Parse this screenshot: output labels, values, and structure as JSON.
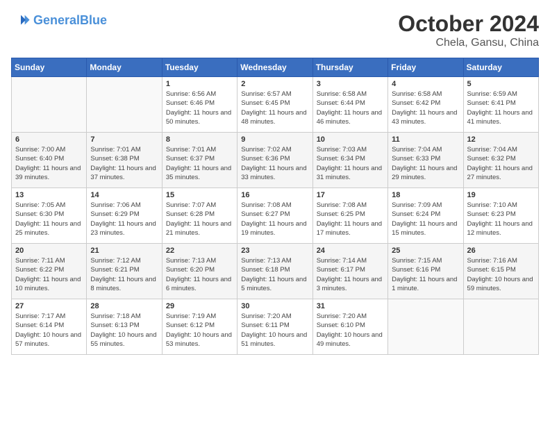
{
  "header": {
    "logo_line1": "General",
    "logo_line2": "Blue",
    "month": "October 2024",
    "location": "Chela, Gansu, China"
  },
  "weekdays": [
    "Sunday",
    "Monday",
    "Tuesday",
    "Wednesday",
    "Thursday",
    "Friday",
    "Saturday"
  ],
  "weeks": [
    [
      {
        "day": "",
        "detail": ""
      },
      {
        "day": "",
        "detail": ""
      },
      {
        "day": "1",
        "detail": "Sunrise: 6:56 AM\nSunset: 6:46 PM\nDaylight: 11 hours\nand 50 minutes."
      },
      {
        "day": "2",
        "detail": "Sunrise: 6:57 AM\nSunset: 6:45 PM\nDaylight: 11 hours\nand 48 minutes."
      },
      {
        "day": "3",
        "detail": "Sunrise: 6:58 AM\nSunset: 6:44 PM\nDaylight: 11 hours\nand 46 minutes."
      },
      {
        "day": "4",
        "detail": "Sunrise: 6:58 AM\nSunset: 6:42 PM\nDaylight: 11 hours\nand 43 minutes."
      },
      {
        "day": "5",
        "detail": "Sunrise: 6:59 AM\nSunset: 6:41 PM\nDaylight: 11 hours\nand 41 minutes."
      }
    ],
    [
      {
        "day": "6",
        "detail": "Sunrise: 7:00 AM\nSunset: 6:40 PM\nDaylight: 11 hours\nand 39 minutes."
      },
      {
        "day": "7",
        "detail": "Sunrise: 7:01 AM\nSunset: 6:38 PM\nDaylight: 11 hours\nand 37 minutes."
      },
      {
        "day": "8",
        "detail": "Sunrise: 7:01 AM\nSunset: 6:37 PM\nDaylight: 11 hours\nand 35 minutes."
      },
      {
        "day": "9",
        "detail": "Sunrise: 7:02 AM\nSunset: 6:36 PM\nDaylight: 11 hours\nand 33 minutes."
      },
      {
        "day": "10",
        "detail": "Sunrise: 7:03 AM\nSunset: 6:34 PM\nDaylight: 11 hours\nand 31 minutes."
      },
      {
        "day": "11",
        "detail": "Sunrise: 7:04 AM\nSunset: 6:33 PM\nDaylight: 11 hours\nand 29 minutes."
      },
      {
        "day": "12",
        "detail": "Sunrise: 7:04 AM\nSunset: 6:32 PM\nDaylight: 11 hours\nand 27 minutes."
      }
    ],
    [
      {
        "day": "13",
        "detail": "Sunrise: 7:05 AM\nSunset: 6:30 PM\nDaylight: 11 hours\nand 25 minutes."
      },
      {
        "day": "14",
        "detail": "Sunrise: 7:06 AM\nSunset: 6:29 PM\nDaylight: 11 hours\nand 23 minutes."
      },
      {
        "day": "15",
        "detail": "Sunrise: 7:07 AM\nSunset: 6:28 PM\nDaylight: 11 hours\nand 21 minutes."
      },
      {
        "day": "16",
        "detail": "Sunrise: 7:08 AM\nSunset: 6:27 PM\nDaylight: 11 hours\nand 19 minutes."
      },
      {
        "day": "17",
        "detail": "Sunrise: 7:08 AM\nSunset: 6:25 PM\nDaylight: 11 hours\nand 17 minutes."
      },
      {
        "day": "18",
        "detail": "Sunrise: 7:09 AM\nSunset: 6:24 PM\nDaylight: 11 hours\nand 15 minutes."
      },
      {
        "day": "19",
        "detail": "Sunrise: 7:10 AM\nSunset: 6:23 PM\nDaylight: 11 hours\nand 12 minutes."
      }
    ],
    [
      {
        "day": "20",
        "detail": "Sunrise: 7:11 AM\nSunset: 6:22 PM\nDaylight: 11 hours\nand 10 minutes."
      },
      {
        "day": "21",
        "detail": "Sunrise: 7:12 AM\nSunset: 6:21 PM\nDaylight: 11 hours\nand 8 minutes."
      },
      {
        "day": "22",
        "detail": "Sunrise: 7:13 AM\nSunset: 6:20 PM\nDaylight: 11 hours\nand 6 minutes."
      },
      {
        "day": "23",
        "detail": "Sunrise: 7:13 AM\nSunset: 6:18 PM\nDaylight: 11 hours\nand 5 minutes."
      },
      {
        "day": "24",
        "detail": "Sunrise: 7:14 AM\nSunset: 6:17 PM\nDaylight: 11 hours\nand 3 minutes."
      },
      {
        "day": "25",
        "detail": "Sunrise: 7:15 AM\nSunset: 6:16 PM\nDaylight: 11 hours\nand 1 minute."
      },
      {
        "day": "26",
        "detail": "Sunrise: 7:16 AM\nSunset: 6:15 PM\nDaylight: 10 hours\nand 59 minutes."
      }
    ],
    [
      {
        "day": "27",
        "detail": "Sunrise: 7:17 AM\nSunset: 6:14 PM\nDaylight: 10 hours\nand 57 minutes."
      },
      {
        "day": "28",
        "detail": "Sunrise: 7:18 AM\nSunset: 6:13 PM\nDaylight: 10 hours\nand 55 minutes."
      },
      {
        "day": "29",
        "detail": "Sunrise: 7:19 AM\nSunset: 6:12 PM\nDaylight: 10 hours\nand 53 minutes."
      },
      {
        "day": "30",
        "detail": "Sunrise: 7:20 AM\nSunset: 6:11 PM\nDaylight: 10 hours\nand 51 minutes."
      },
      {
        "day": "31",
        "detail": "Sunrise: 7:20 AM\nSunset: 6:10 PM\nDaylight: 10 hours\nand 49 minutes."
      },
      {
        "day": "",
        "detail": ""
      },
      {
        "day": "",
        "detail": ""
      }
    ]
  ]
}
